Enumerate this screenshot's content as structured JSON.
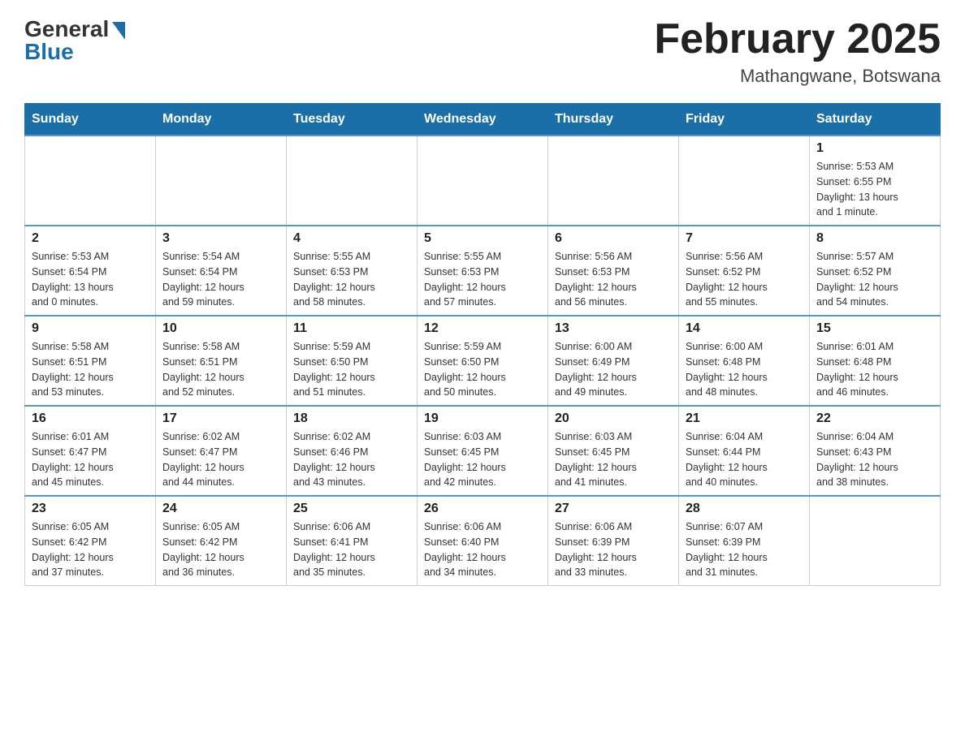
{
  "header": {
    "logo_general": "General",
    "logo_blue": "Blue",
    "month_title": "February 2025",
    "location": "Mathangwane, Botswana"
  },
  "days_of_week": [
    "Sunday",
    "Monday",
    "Tuesday",
    "Wednesday",
    "Thursday",
    "Friday",
    "Saturday"
  ],
  "weeks": [
    [
      {
        "day": "",
        "info": ""
      },
      {
        "day": "",
        "info": ""
      },
      {
        "day": "",
        "info": ""
      },
      {
        "day": "",
        "info": ""
      },
      {
        "day": "",
        "info": ""
      },
      {
        "day": "",
        "info": ""
      },
      {
        "day": "1",
        "info": "Sunrise: 5:53 AM\nSunset: 6:55 PM\nDaylight: 13 hours\nand 1 minute."
      }
    ],
    [
      {
        "day": "2",
        "info": "Sunrise: 5:53 AM\nSunset: 6:54 PM\nDaylight: 13 hours\nand 0 minutes."
      },
      {
        "day": "3",
        "info": "Sunrise: 5:54 AM\nSunset: 6:54 PM\nDaylight: 12 hours\nand 59 minutes."
      },
      {
        "day": "4",
        "info": "Sunrise: 5:55 AM\nSunset: 6:53 PM\nDaylight: 12 hours\nand 58 minutes."
      },
      {
        "day": "5",
        "info": "Sunrise: 5:55 AM\nSunset: 6:53 PM\nDaylight: 12 hours\nand 57 minutes."
      },
      {
        "day": "6",
        "info": "Sunrise: 5:56 AM\nSunset: 6:53 PM\nDaylight: 12 hours\nand 56 minutes."
      },
      {
        "day": "7",
        "info": "Sunrise: 5:56 AM\nSunset: 6:52 PM\nDaylight: 12 hours\nand 55 minutes."
      },
      {
        "day": "8",
        "info": "Sunrise: 5:57 AM\nSunset: 6:52 PM\nDaylight: 12 hours\nand 54 minutes."
      }
    ],
    [
      {
        "day": "9",
        "info": "Sunrise: 5:58 AM\nSunset: 6:51 PM\nDaylight: 12 hours\nand 53 minutes."
      },
      {
        "day": "10",
        "info": "Sunrise: 5:58 AM\nSunset: 6:51 PM\nDaylight: 12 hours\nand 52 minutes."
      },
      {
        "day": "11",
        "info": "Sunrise: 5:59 AM\nSunset: 6:50 PM\nDaylight: 12 hours\nand 51 minutes."
      },
      {
        "day": "12",
        "info": "Sunrise: 5:59 AM\nSunset: 6:50 PM\nDaylight: 12 hours\nand 50 minutes."
      },
      {
        "day": "13",
        "info": "Sunrise: 6:00 AM\nSunset: 6:49 PM\nDaylight: 12 hours\nand 49 minutes."
      },
      {
        "day": "14",
        "info": "Sunrise: 6:00 AM\nSunset: 6:48 PM\nDaylight: 12 hours\nand 48 minutes."
      },
      {
        "day": "15",
        "info": "Sunrise: 6:01 AM\nSunset: 6:48 PM\nDaylight: 12 hours\nand 46 minutes."
      }
    ],
    [
      {
        "day": "16",
        "info": "Sunrise: 6:01 AM\nSunset: 6:47 PM\nDaylight: 12 hours\nand 45 minutes."
      },
      {
        "day": "17",
        "info": "Sunrise: 6:02 AM\nSunset: 6:47 PM\nDaylight: 12 hours\nand 44 minutes."
      },
      {
        "day": "18",
        "info": "Sunrise: 6:02 AM\nSunset: 6:46 PM\nDaylight: 12 hours\nand 43 minutes."
      },
      {
        "day": "19",
        "info": "Sunrise: 6:03 AM\nSunset: 6:45 PM\nDaylight: 12 hours\nand 42 minutes."
      },
      {
        "day": "20",
        "info": "Sunrise: 6:03 AM\nSunset: 6:45 PM\nDaylight: 12 hours\nand 41 minutes."
      },
      {
        "day": "21",
        "info": "Sunrise: 6:04 AM\nSunset: 6:44 PM\nDaylight: 12 hours\nand 40 minutes."
      },
      {
        "day": "22",
        "info": "Sunrise: 6:04 AM\nSunset: 6:43 PM\nDaylight: 12 hours\nand 38 minutes."
      }
    ],
    [
      {
        "day": "23",
        "info": "Sunrise: 6:05 AM\nSunset: 6:42 PM\nDaylight: 12 hours\nand 37 minutes."
      },
      {
        "day": "24",
        "info": "Sunrise: 6:05 AM\nSunset: 6:42 PM\nDaylight: 12 hours\nand 36 minutes."
      },
      {
        "day": "25",
        "info": "Sunrise: 6:06 AM\nSunset: 6:41 PM\nDaylight: 12 hours\nand 35 minutes."
      },
      {
        "day": "26",
        "info": "Sunrise: 6:06 AM\nSunset: 6:40 PM\nDaylight: 12 hours\nand 34 minutes."
      },
      {
        "day": "27",
        "info": "Sunrise: 6:06 AM\nSunset: 6:39 PM\nDaylight: 12 hours\nand 33 minutes."
      },
      {
        "day": "28",
        "info": "Sunrise: 6:07 AM\nSunset: 6:39 PM\nDaylight: 12 hours\nand 31 minutes."
      },
      {
        "day": "",
        "info": ""
      }
    ]
  ]
}
